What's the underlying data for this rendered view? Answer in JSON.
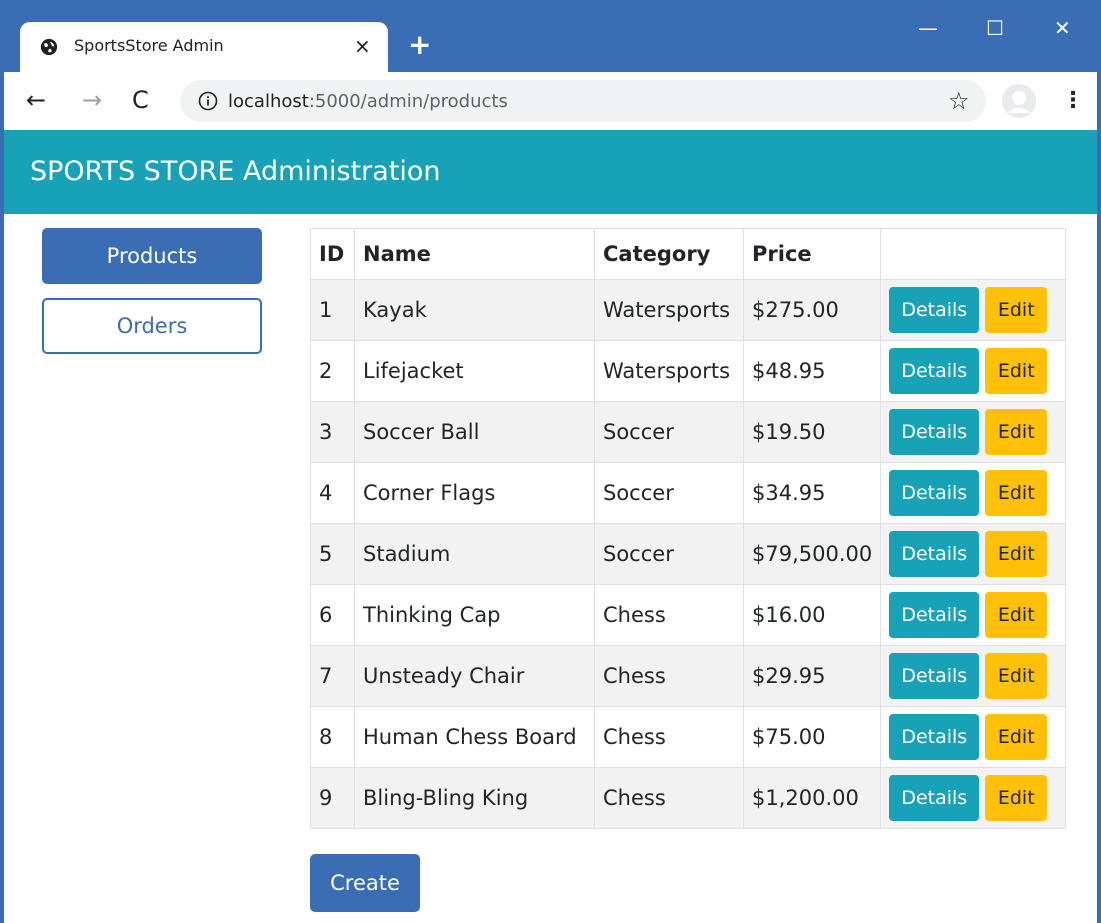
{
  "browser": {
    "tab_title": "SportsStore Admin",
    "tab_close": "×",
    "new_tab": "+",
    "window_controls": {
      "minimize": "—",
      "maximize": "☐",
      "close": "✕"
    },
    "nav": {
      "back": "←",
      "forward": "→",
      "reload": "C"
    },
    "url_host": "localhost",
    "url_rest": ":5000/admin/products",
    "star": "☆",
    "menu": "⋮"
  },
  "header": {
    "title": "SPORTS STORE Administration"
  },
  "sidebar": {
    "items": [
      {
        "label": "Products"
      },
      {
        "label": "Orders"
      }
    ]
  },
  "table": {
    "columns": [
      "ID",
      "Name",
      "Category",
      "Price",
      ""
    ],
    "rows": [
      {
        "id": "1",
        "name": "Kayak",
        "category": "Watersports",
        "price": "$275.00"
      },
      {
        "id": "2",
        "name": "Lifejacket",
        "category": "Watersports",
        "price": "$48.95"
      },
      {
        "id": "3",
        "name": "Soccer Ball",
        "category": "Soccer",
        "price": "$19.50"
      },
      {
        "id": "4",
        "name": "Corner Flags",
        "category": "Soccer",
        "price": "$34.95"
      },
      {
        "id": "5",
        "name": "Stadium",
        "category": "Soccer",
        "price": "$79,500.00"
      },
      {
        "id": "6",
        "name": "Thinking Cap",
        "category": "Chess",
        "price": "$16.00"
      },
      {
        "id": "7",
        "name": "Unsteady Chair",
        "category": "Chess",
        "price": "$29.95"
      },
      {
        "id": "8",
        "name": "Human Chess Board",
        "category": "Chess",
        "price": "$75.00"
      },
      {
        "id": "9",
        "name": "Bling-Bling King",
        "category": "Chess",
        "price": "$1,200.00"
      }
    ],
    "details_label": "Details",
    "edit_label": "Edit"
  },
  "create_label": "Create",
  "colors": {
    "chrome_blue": "#3a6db3",
    "header_teal": "#17a2b8",
    "edit_yellow": "#ffc107"
  }
}
